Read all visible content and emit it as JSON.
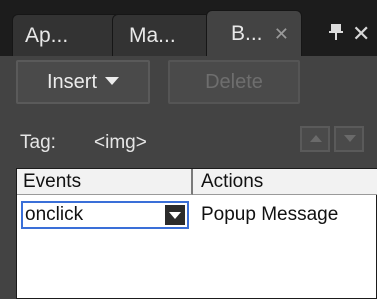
{
  "tabs": [
    {
      "label": "Ap..."
    },
    {
      "label": "Ma..."
    },
    {
      "label": "B...",
      "active": true
    }
  ],
  "toolbar": {
    "insert_label": "Insert",
    "delete_label": "Delete"
  },
  "tag": {
    "label": "Tag:",
    "value": "<img>"
  },
  "table": {
    "headers": [
      "Events",
      "Actions"
    ],
    "rows": [
      {
        "event": "onclick",
        "action": "Popup Message"
      }
    ]
  },
  "icons": {
    "tab_close": "close-icon",
    "pin": "pin-icon",
    "panel_close": "close-icon",
    "insert_caret": "chevron-down-icon",
    "up": "arrow-up-icon",
    "down": "arrow-down-icon",
    "select_drop": "chevron-down-icon"
  },
  "colors": {
    "selection_border": "#3a6fd8",
    "panel_bg": "#434343",
    "tabbar_bg": "#1c1c1c"
  }
}
